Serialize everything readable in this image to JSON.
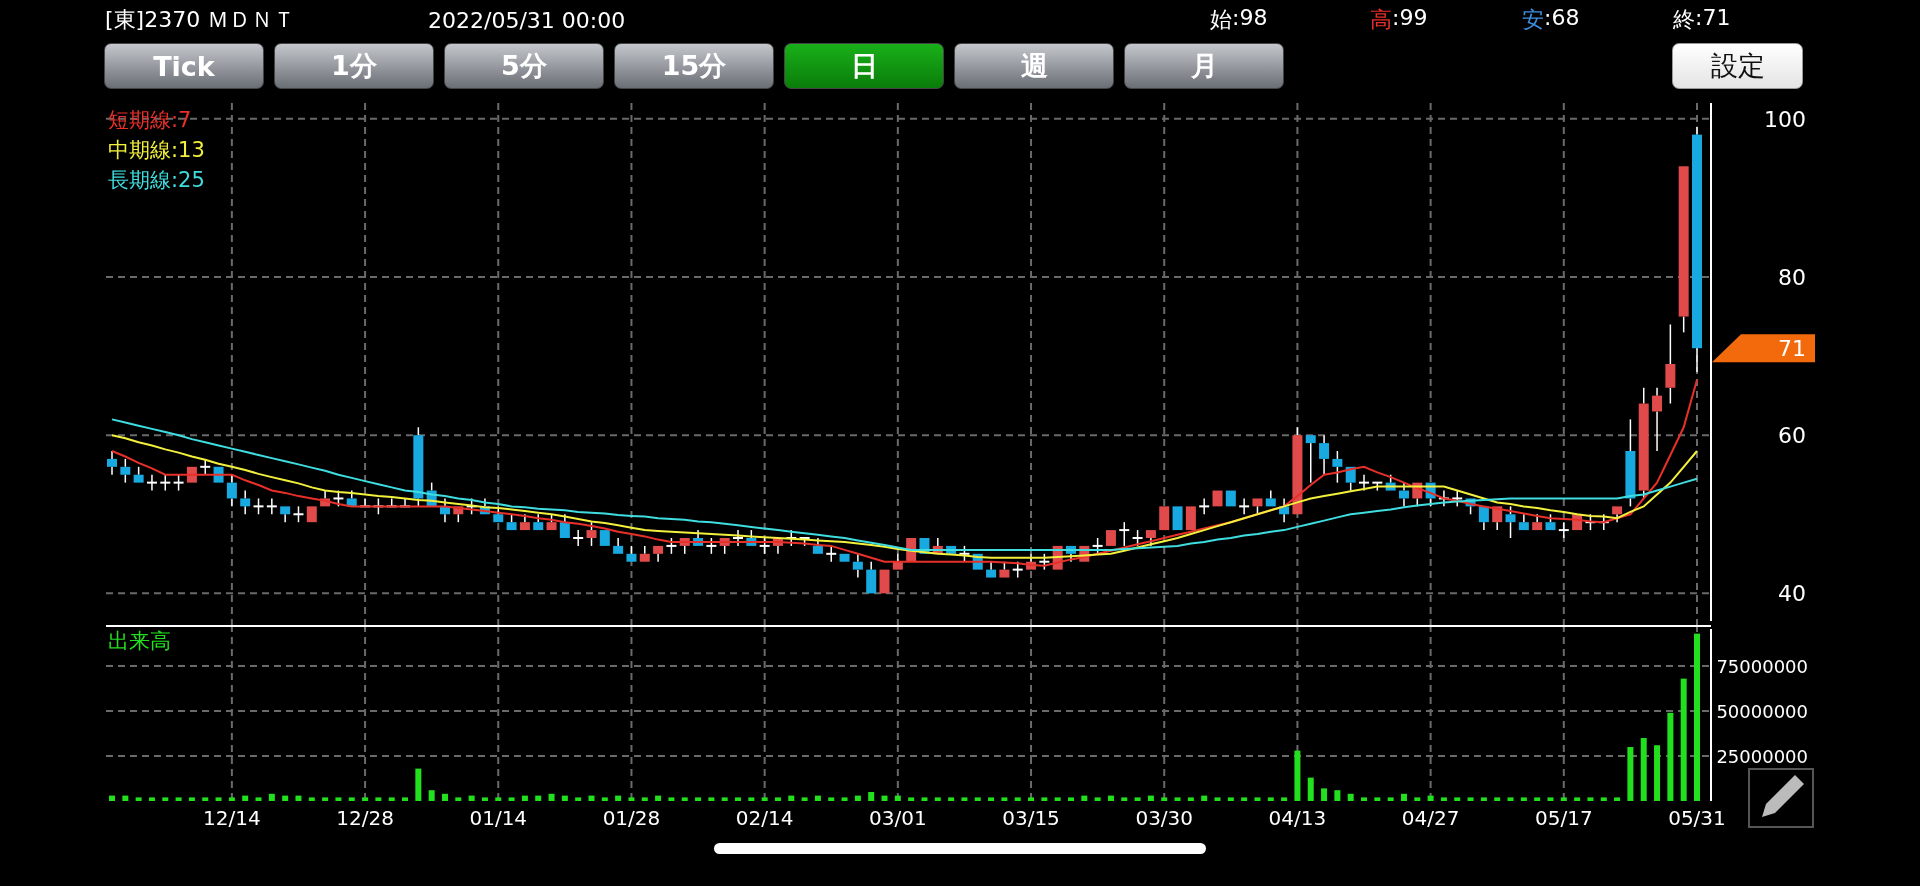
{
  "header": {
    "symbol": "[東]2370 ＭＤＮＴ",
    "datetime": "2022/05/31 00:00",
    "quotes": [
      {
        "label": "始",
        "value": ":98",
        "color": "#ffffff"
      },
      {
        "label": "高",
        "value": ":99",
        "color": "#e8302a"
      },
      {
        "label": "安",
        "value": ":68",
        "color": "#3d8fe0"
      },
      {
        "label": "終",
        "value": ":71",
        "color": "#ffffff"
      }
    ]
  },
  "tabs": [
    {
      "label": "Tick",
      "selected": false
    },
    {
      "label": "1分",
      "selected": false
    },
    {
      "label": "5分",
      "selected": false
    },
    {
      "label": "15分",
      "selected": false
    },
    {
      "label": "日",
      "selected": true
    },
    {
      "label": "週",
      "selected": false
    },
    {
      "label": "月",
      "selected": false
    }
  ],
  "settings_button": "設定",
  "price_chart": {
    "last_price_marker": "71",
    "chart_data": {
      "type": "candlestick",
      "grid": true,
      "ylim": [
        36,
        102
      ],
      "yticks": [
        40,
        60,
        80,
        100
      ],
      "categories": [
        null,
        null,
        null,
        null,
        null,
        null,
        null,
        null,
        null,
        null,
        null,
        null,
        null,
        null,
        null,
        null,
        null,
        null,
        null,
        null,
        null,
        null,
        null,
        null,
        null,
        null,
        null,
        null,
        null,
        null,
        null,
        null,
        null,
        null,
        null,
        null,
        null,
        null,
        null,
        null,
        null,
        null,
        null,
        null,
        null,
        null,
        null,
        null,
        null,
        null,
        null,
        null,
        null,
        null,
        null,
        null,
        null,
        null,
        null,
        null,
        null,
        null,
        null,
        null,
        null,
        null,
        null,
        null,
        null,
        null,
        null,
        null,
        null,
        null,
        null,
        null,
        null,
        null,
        null,
        null,
        null,
        null,
        null,
        null,
        null,
        null,
        null,
        null,
        null,
        null,
        null,
        null,
        null,
        null,
        null,
        null,
        null,
        null,
        null,
        null,
        null,
        null,
        null,
        null,
        null,
        null,
        null,
        null,
        null,
        null,
        null,
        null,
        null,
        null,
        null,
        null,
        null,
        null,
        null,
        null
      ],
      "ohlc": [
        [
          57,
          58,
          55,
          56
        ],
        [
          56,
          57,
          54,
          55
        ],
        [
          55,
          56,
          54,
          54
        ],
        [
          54,
          55,
          53,
          54
        ],
        [
          54,
          55,
          53,
          54
        ],
        [
          54,
          55,
          53,
          54
        ],
        [
          54,
          56,
          54,
          56
        ],
        [
          56,
          57,
          55,
          56
        ],
        [
          56,
          56,
          54,
          54
        ],
        [
          54,
          55,
          51,
          52
        ],
        [
          52,
          53,
          50,
          51
        ],
        [
          51,
          52,
          50,
          51
        ],
        [
          51,
          52,
          50,
          51
        ],
        [
          51,
          51,
          49,
          50
        ],
        [
          50,
          51,
          49,
          50
        ],
        [
          49,
          51,
          49,
          51
        ],
        [
          51,
          53,
          51,
          52
        ],
        [
          52,
          53,
          51,
          52
        ],
        [
          52,
          53,
          51,
          51
        ],
        [
          51,
          52,
          51,
          51
        ],
        [
          51,
          52,
          50,
          51
        ],
        [
          51,
          52,
          51,
          51
        ],
        [
          51,
          52,
          51,
          51
        ],
        [
          60,
          61,
          51,
          52
        ],
        [
          53,
          54,
          51,
          51
        ],
        [
          51,
          52,
          49,
          50
        ],
        [
          50,
          51,
          49,
          51
        ],
        [
          51,
          52,
          50,
          51
        ],
        [
          51,
          52,
          50,
          50
        ],
        [
          50,
          51,
          49,
          49
        ],
        [
          49,
          50,
          48,
          48
        ],
        [
          48,
          50,
          48,
          49
        ],
        [
          49,
          50,
          48,
          48
        ],
        [
          48,
          50,
          48,
          49
        ],
        [
          49,
          50,
          47,
          47
        ],
        [
          47,
          48,
          46,
          47
        ],
        [
          47,
          49,
          46,
          48
        ],
        [
          48,
          48,
          46,
          46
        ],
        [
          46,
          47,
          45,
          45
        ],
        [
          45,
          46,
          44,
          44
        ],
        [
          44,
          46,
          44,
          45
        ],
        [
          45,
          46,
          44,
          46
        ],
        [
          46,
          47,
          45,
          46
        ],
        [
          46,
          47,
          45,
          47
        ],
        [
          47,
          48,
          46,
          46
        ],
        [
          46,
          47,
          45,
          46
        ],
        [
          46,
          47,
          45,
          47
        ],
        [
          47,
          48,
          46,
          47
        ],
        [
          47,
          48,
          46,
          46
        ],
        [
          46,
          47,
          45,
          46
        ],
        [
          46,
          47,
          45,
          47
        ],
        [
          47,
          48,
          46,
          47
        ],
        [
          47,
          47,
          46,
          47
        ],
        [
          46,
          47,
          45,
          45
        ],
        [
          45,
          46,
          44,
          45
        ],
        [
          45,
          45,
          44,
          44
        ],
        [
          44,
          45,
          42,
          43
        ],
        [
          43,
          44,
          40,
          40
        ],
        [
          40,
          43,
          40,
          43
        ],
        [
          43,
          45,
          43,
          44
        ],
        [
          44,
          47,
          44,
          47
        ],
        [
          47,
          47,
          45,
          45
        ],
        [
          45,
          47,
          45,
          46
        ],
        [
          46,
          46,
          45,
          45
        ],
        [
          45,
          46,
          44,
          45
        ],
        [
          45,
          45,
          43,
          43
        ],
        [
          43,
          44,
          42,
          42
        ],
        [
          42,
          44,
          42,
          43
        ],
        [
          43,
          44,
          42,
          43
        ],
        [
          43,
          45,
          43,
          44
        ],
        [
          44,
          45,
          43,
          44
        ],
        [
          43,
          46,
          43,
          46
        ],
        [
          46,
          46,
          44,
          45
        ],
        [
          44,
          46,
          44,
          46
        ],
        [
          46,
          47,
          45,
          46
        ],
        [
          46,
          48,
          46,
          48
        ],
        [
          48,
          49,
          46,
          48
        ],
        [
          47,
          48,
          46,
          47
        ],
        [
          47,
          48,
          46,
          48
        ],
        [
          48,
          51,
          48,
          51
        ],
        [
          51,
          51,
          48,
          48
        ],
        [
          48,
          51,
          48,
          51
        ],
        [
          51,
          52,
          50,
          51
        ],
        [
          51,
          53,
          51,
          53
        ],
        [
          53,
          53,
          51,
          51
        ],
        [
          51,
          52,
          50,
          51
        ],
        [
          51,
          52,
          50,
          52
        ],
        [
          52,
          53,
          51,
          51
        ],
        [
          51,
          52,
          49,
          50
        ],
        [
          50,
          61,
          50,
          60
        ],
        [
          60,
          60,
          54,
          59
        ],
        [
          59,
          60,
          55,
          57
        ],
        [
          57,
          58,
          54,
          56
        ],
        [
          56,
          56,
          53,
          54
        ],
        [
          54,
          55,
          53,
          54
        ],
        [
          54,
          54,
          53,
          54
        ],
        [
          54,
          55,
          53,
          53
        ],
        [
          53,
          54,
          51,
          52
        ],
        [
          52,
          54,
          51,
          54
        ],
        [
          54,
          54,
          51,
          52
        ],
        [
          52,
          53,
          51,
          52
        ],
        [
          52,
          53,
          51,
          52
        ],
        [
          52,
          52,
          50,
          51
        ],
        [
          51,
          51,
          48,
          49
        ],
        [
          49,
          51,
          48,
          51
        ],
        [
          50,
          51,
          47,
          49
        ],
        [
          49,
          50,
          48,
          48
        ],
        [
          48,
          50,
          48,
          49
        ],
        [
          49,
          50,
          48,
          48
        ],
        [
          48,
          49,
          47,
          48
        ],
        [
          48,
          50,
          48,
          50
        ],
        [
          49,
          50,
          48,
          49
        ],
        [
          49,
          50,
          48,
          49
        ],
        [
          50,
          51,
          49,
          51
        ],
        [
          58,
          62,
          51,
          52
        ],
        [
          53,
          66,
          52,
          64
        ],
        [
          63,
          66,
          58,
          65
        ],
        [
          66,
          74,
          64,
          69
        ],
        [
          75,
          94,
          73,
          94
        ],
        [
          98,
          99,
          68,
          71
        ]
      ],
      "series": [
        {
          "name": "短期線:7",
          "type": "line",
          "color": "#e8302a",
          "values": [
            58,
            57.3,
            56.5,
            55.8,
            55,
            55,
            55,
            55,
            55,
            55,
            54.3,
            53.7,
            53,
            52.7,
            52.3,
            52,
            51.7,
            51.3,
            51,
            51,
            51,
            51,
            51,
            51,
            51,
            51,
            50.8,
            50.6,
            50.4,
            50.2,
            50,
            49.8,
            49.5,
            49.3,
            49,
            48.8,
            48.5,
            48.2,
            47.8,
            47.5,
            47.2,
            46.8,
            46.5,
            46.5,
            46.5,
            46.5,
            46.5,
            46.5,
            46.5,
            46.5,
            46.5,
            46.4,
            46.3,
            46.1,
            46,
            45.5,
            45,
            44.5,
            44,
            44,
            44,
            44,
            44,
            44,
            44,
            44,
            44,
            43.9,
            43.8,
            43.6,
            43.5,
            43.9,
            44.3,
            44.6,
            45,
            45.4,
            45.8,
            46.2,
            46.6,
            47,
            47.4,
            47.8,
            48.2,
            48.6,
            49,
            49.5,
            50,
            50.5,
            51,
            52.3,
            53.7,
            55,
            55.3,
            55.7,
            56,
            55.3,
            54.7,
            54,
            53.3,
            52.7,
            52,
            51.7,
            51.3,
            51,
            50.7,
            50.4,
            50.1,
            49.8,
            49.5,
            49.4,
            49.3,
            49.1,
            49,
            49.5,
            50,
            52,
            54,
            57.5,
            61,
            67
          ]
        },
        {
          "name": "中期線:13",
          "type": "line",
          "color": "#f2f03c",
          "values": [
            60,
            59.6,
            59.1,
            58.7,
            58.2,
            57.8,
            57.3,
            56.9,
            56.4,
            56,
            55.6,
            55.1,
            54.7,
            54.3,
            53.9,
            53.4,
            53,
            52.8,
            52.7,
            52.5,
            52.3,
            52.2,
            52,
            51.8,
            51.7,
            51.5,
            51.3,
            51.1,
            50.9,
            50.8,
            50.6,
            50.4,
            50.2,
            50,
            49.7,
            49.4,
            49.1,
            48.9,
            48.6,
            48.3,
            48,
            47.9,
            47.8,
            47.7,
            47.6,
            47.5,
            47.4,
            47.3,
            47.2,
            47.1,
            47,
            46.9,
            46.8,
            46.7,
            46.6,
            46.5,
            46.3,
            46.1,
            45.9,
            45.6,
            45.4,
            45.2,
            45,
            44.9,
            44.8,
            44.6,
            44.5,
            44.5,
            44.5,
            44.5,
            44.5,
            44.6,
            44.7,
            44.8,
            44.9,
            45,
            45.4,
            45.8,
            46.2,
            46.6,
            47,
            47.5,
            48,
            48.5,
            49,
            49.5,
            50,
            50.5,
            51,
            51.5,
            52,
            52.3,
            52.6,
            52.9,
            53.2,
            53.5,
            53.5,
            53.5,
            53.5,
            53.5,
            53.5,
            53,
            52.5,
            52,
            51.5,
            51.3,
            51,
            50.8,
            50.5,
            50.3,
            50,
            49.8,
            49.7,
            49.5,
            50.3,
            51,
            52.5,
            54,
            56,
            58
          ]
        },
        {
          "name": "長期線:25",
          "type": "line",
          "color": "#3fdde0",
          "values": [
            62,
            61.6,
            61.2,
            60.8,
            60.4,
            60,
            59.5,
            59.1,
            58.7,
            58.3,
            57.9,
            57.5,
            57.1,
            56.7,
            56.3,
            55.9,
            55.5,
            55,
            54.6,
            54.2,
            53.8,
            53.4,
            53,
            52.8,
            52.5,
            52.3,
            52,
            51.8,
            51.5,
            51.3,
            51,
            50.9,
            50.7,
            50.6,
            50.5,
            50.3,
            50.2,
            50.1,
            49.9,
            49.8,
            49.7,
            49.5,
            49.4,
            49.3,
            49.1,
            49,
            48.8,
            48.6,
            48.4,
            48.2,
            48,
            47.8,
            47.6,
            47.4,
            47.2,
            47,
            46.7,
            46.4,
            46.1,
            45.8,
            45.5,
            45.5,
            45.5,
            45.5,
            45.5,
            45.5,
            45.5,
            45.5,
            45.5,
            45.5,
            45.5,
            45.5,
            45.5,
            45.5,
            45.5,
            45.5,
            45.6,
            45.7,
            45.8,
            45.9,
            46,
            46.3,
            46.5,
            46.8,
            47,
            47.3,
            47.5,
            47.8,
            48,
            48.4,
            48.8,
            49.2,
            49.6,
            50,
            50.2,
            50.4,
            50.6,
            50.9,
            51.1,
            51.3,
            51.5,
            51.6,
            51.7,
            51.8,
            51.9,
            52,
            52,
            52,
            52,
            52,
            52,
            52,
            52,
            52,
            52.3,
            52.5,
            53,
            53.5,
            54,
            54.5
          ]
        }
      ]
    }
  },
  "volume_chart": {
    "title": "出来高",
    "chart_data": {
      "type": "bar",
      "grid": true,
      "ylim": [
        0,
        97800000
      ],
      "yticks": [
        {
          "value": 25000000,
          "label": "25000000"
        },
        {
          "value": 50000000,
          "label": "50000000"
        },
        {
          "value": 75000000,
          "label": "75000000"
        }
      ],
      "categories": [
        null,
        null,
        null,
        null,
        null,
        null,
        null,
        null,
        null,
        "12/14",
        null,
        null,
        null,
        null,
        null,
        null,
        null,
        null,
        null,
        "12/28",
        null,
        null,
        null,
        null,
        null,
        null,
        null,
        null,
        null,
        "01/14",
        null,
        null,
        null,
        null,
        null,
        null,
        null,
        null,
        null,
        "01/28",
        null,
        null,
        null,
        null,
        null,
        null,
        null,
        null,
        null,
        "02/14",
        null,
        null,
        null,
        null,
        null,
        null,
        null,
        null,
        null,
        "03/01",
        null,
        null,
        null,
        null,
        null,
        null,
        null,
        null,
        null,
        "03/15",
        null,
        null,
        null,
        null,
        null,
        null,
        null,
        null,
        null,
        "03/30",
        null,
        null,
        null,
        null,
        null,
        null,
        null,
        null,
        null,
        "04/13",
        null,
        null,
        null,
        null,
        null,
        null,
        null,
        null,
        null,
        "04/27",
        null,
        null,
        null,
        null,
        null,
        null,
        null,
        null,
        null,
        "05/17",
        null,
        null,
        null,
        null,
        null,
        null,
        null,
        null,
        null,
        "05/31"
      ],
      "series": [
        {
          "color": "#22e01e",
          "values": [
            3000000,
            3000000,
            2000000,
            2000000,
            2000000,
            2000000,
            2000000,
            2000000,
            2000000,
            2000000,
            3000000,
            2000000,
            4000000,
            3000000,
            3000000,
            2000000,
            2000000,
            2000000,
            2000000,
            2000000,
            2000000,
            2000000,
            2000000,
            18000000,
            6000000,
            4000000,
            2000000,
            3000000,
            2000000,
            2000000,
            2000000,
            3000000,
            3000000,
            4000000,
            3000000,
            2000000,
            3000000,
            2000000,
            3000000,
            2000000,
            2000000,
            3000000,
            2000000,
            2000000,
            2000000,
            2000000,
            2000000,
            2000000,
            2000000,
            2000000,
            2000000,
            3000000,
            2000000,
            3000000,
            2000000,
            2000000,
            3000000,
            5000000,
            3000000,
            3000000,
            2000000,
            2000000,
            2000000,
            2000000,
            2000000,
            2000000,
            2000000,
            2000000,
            2000000,
            2000000,
            2000000,
            2000000,
            2000000,
            3000000,
            2000000,
            3000000,
            2000000,
            2000000,
            3000000,
            2000000,
            2000000,
            2000000,
            3000000,
            2000000,
            2000000,
            2000000,
            2000000,
            2000000,
            2000000,
            28000000,
            13000000,
            7000000,
            6000000,
            4000000,
            2000000,
            2000000,
            2000000,
            4000000,
            2000000,
            3000000,
            2000000,
            2000000,
            2000000,
            2000000,
            2000000,
            2000000,
            2000000,
            2000000,
            2000000,
            2000000,
            2000000,
            2000000,
            2000000,
            2000000,
            30000000,
            35000000,
            31000000,
            49000000,
            68000000,
            93000000
          ]
        }
      ]
    }
  }
}
